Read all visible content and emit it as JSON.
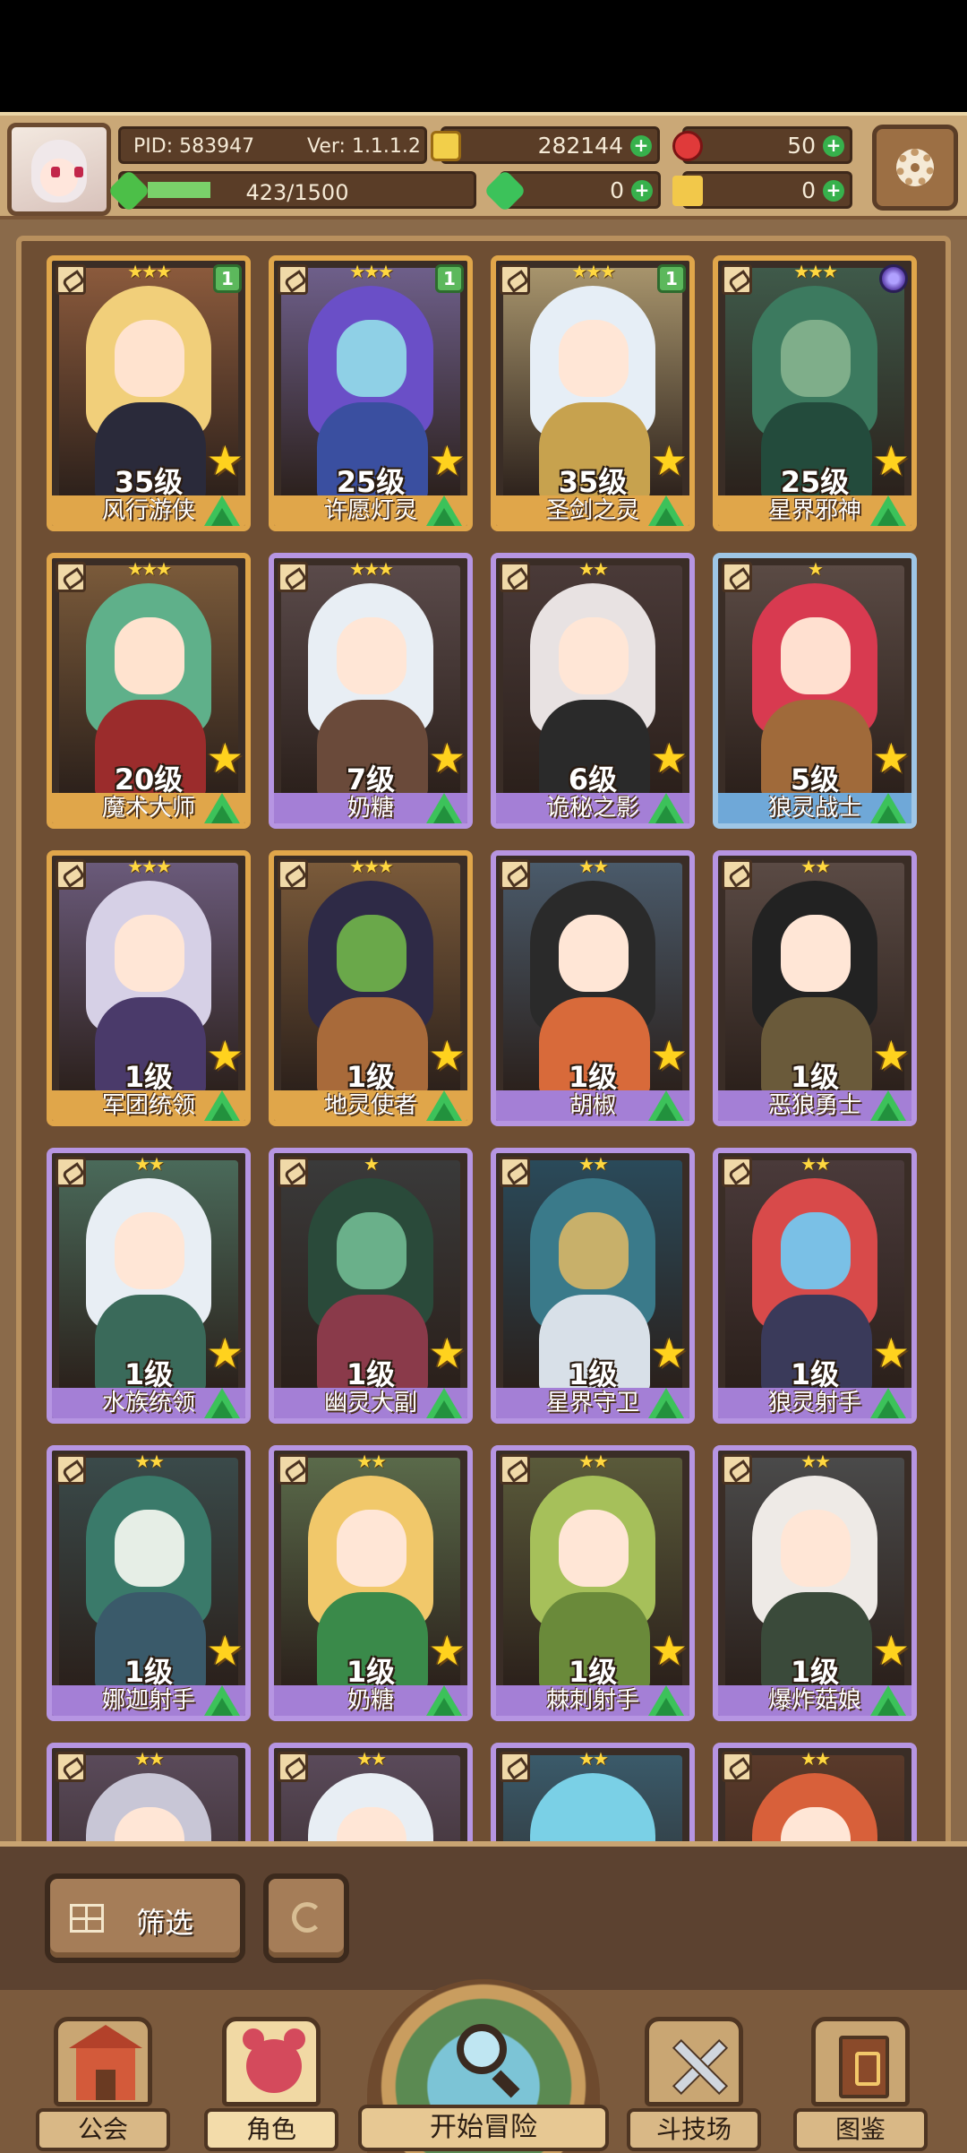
{
  "header": {
    "pid": "PID: 583947",
    "version": "Ver: 1.1.1.2",
    "gold": "282144",
    "gems": "50",
    "xp": "423/1500",
    "clover": "0",
    "key": "0"
  },
  "colors": {
    "orange_frame": "#e0a64a",
    "purple_frame": "#b695e2",
    "blue_frame": "#9ec6e6",
    "upgrade": "#3cc25a"
  },
  "cards": [
    {
      "name": "风行游侠",
      "level": "35级",
      "stars": "★★★",
      "rarity": "orange",
      "badge": "1",
      "hair": "#f1cf7a",
      "skin": "#ffe3cf",
      "body": "#2a2a3a",
      "bg": "#8b5a3c"
    },
    {
      "name": "许愿灯灵",
      "level": "25级",
      "stars": "★★★",
      "rarity": "orange",
      "badge": "1",
      "hair": "#6a4fc7",
      "skin": "#8fd0e6",
      "body": "#3a4fa0",
      "bg": "#6e5f8a"
    },
    {
      "name": "圣剑之灵",
      "level": "35级",
      "stars": "★★★",
      "rarity": "orange",
      "badge": "1",
      "hair": "#e6eef6",
      "skin": "#ffe6d6",
      "body": "#c7a24e",
      "bg": "#a7946c"
    },
    {
      "name": "星界邪神",
      "level": "25级",
      "stars": "★★★",
      "rarity": "orange",
      "badge": "orb",
      "hair": "#3c7a5f",
      "skin": "#7fae8a",
      "body": "#234b3c",
      "bg": "#3f5a4a"
    },
    {
      "name": "魔术大师",
      "level": "20级",
      "stars": "★★★",
      "rarity": "orange",
      "badge": "",
      "hair": "#5fb08a",
      "skin": "#ffe3cf",
      "body": "#9b2c2c",
      "bg": "#7a5a3a"
    },
    {
      "name": "奶糖",
      "level": "7级",
      "stars": "★★★",
      "rarity": "purple",
      "badge": "",
      "hair": "#e8eef4",
      "skin": "#ffe6d6",
      "body": "#6a4a3a",
      "bg": "#5a4a4a"
    },
    {
      "name": "诡秘之影",
      "level": "6级",
      "stars": "★★",
      "rarity": "purple",
      "badge": "",
      "hair": "#e8e2e2",
      "skin": "#ffe6d6",
      "body": "#2a2a2a",
      "bg": "#4a3a38"
    },
    {
      "name": "狼灵战士",
      "level": "5级",
      "stars": "★",
      "rarity": "blue",
      "badge": "",
      "hair": "#d83a50",
      "skin": "#ffe0d0",
      "body": "#a06a3a",
      "bg": "#5a4a44"
    },
    {
      "name": "军团统领",
      "level": "1级",
      "stars": "★★★",
      "rarity": "orange",
      "badge": "",
      "hair": "#d6d0e6",
      "skin": "#ffe6d6",
      "body": "#4a3a6a",
      "bg": "#6a5a7a"
    },
    {
      "name": "地灵使者",
      "level": "1级",
      "stars": "★★★",
      "rarity": "orange",
      "badge": "",
      "hair": "#2e2a46",
      "skin": "#6aa84a",
      "body": "#a86a3a",
      "bg": "#7a5a3a"
    },
    {
      "name": "胡椒",
      "level": "1级",
      "stars": "★★",
      "rarity": "purple",
      "badge": "",
      "hair": "#2a2a2a",
      "skin": "#ffe6d6",
      "body": "#d86a3a",
      "bg": "#4a5a6a"
    },
    {
      "name": "恶狼勇士",
      "level": "1级",
      "stars": "★★",
      "rarity": "purple",
      "badge": "",
      "hair": "#222",
      "skin": "#ffe6d6",
      "body": "#6a5a3a",
      "bg": "#5a4a44"
    },
    {
      "name": "水族统领",
      "level": "1级",
      "stars": "★★",
      "rarity": "purple",
      "badge": "",
      "hair": "#e8eef4",
      "skin": "#ffe6d6",
      "body": "#3a6a5a",
      "bg": "#4a6a5a"
    },
    {
      "name": "幽灵大副",
      "level": "1级",
      "stars": "★",
      "rarity": "purple",
      "badge": "",
      "hair": "#2a4a3a",
      "skin": "#6ab08a",
      "body": "#8a3a4a",
      "bg": "#3a3a3a"
    },
    {
      "name": "星界守卫",
      "level": "1级",
      "stars": "★★",
      "rarity": "purple",
      "badge": "",
      "hair": "#3a7a8a",
      "skin": "#c8b06a",
      "body": "#d8e0e8",
      "bg": "#2a4a5a"
    },
    {
      "name": "狼灵射手",
      "level": "1级",
      "stars": "★★",
      "rarity": "purple",
      "badge": "",
      "hair": "#d84a4a",
      "skin": "#7ac0e6",
      "body": "#3a3a5a",
      "bg": "#4a3a3a"
    },
    {
      "name": "娜迦射手",
      "level": "1级",
      "stars": "★★",
      "rarity": "purple",
      "badge": "",
      "hair": "#3a7a6a",
      "skin": "#e6eee6",
      "body": "#3a5a6a",
      "bg": "#3a4a4a"
    },
    {
      "name": "奶糖",
      "level": "1级",
      "stars": "★★",
      "rarity": "purple",
      "badge": "",
      "hair": "#f1c86a",
      "skin": "#ffe6d6",
      "body": "#3a8a4a",
      "bg": "#5a6a4a"
    },
    {
      "name": "棘刺射手",
      "level": "1级",
      "stars": "★★",
      "rarity": "purple",
      "badge": "",
      "hair": "#a6c05a",
      "skin": "#ffe6d6",
      "body": "#6a8a3a",
      "bg": "#5a5a3a"
    },
    {
      "name": "爆炸菇娘",
      "level": "1级",
      "stars": "★★",
      "rarity": "purple",
      "badge": "",
      "hair": "#eeeae6",
      "skin": "#ffe6d6",
      "body": "#3a4a3a",
      "bg": "#4a4a4a"
    },
    {
      "name": "",
      "level": "",
      "stars": "★★",
      "rarity": "purple",
      "badge": "",
      "hair": "#c8c6d6",
      "skin": "#ffe6d6",
      "body": "#4a4a5a",
      "bg": "#5a4a5a"
    },
    {
      "name": "",
      "level": "",
      "stars": "★★",
      "rarity": "purple",
      "badge": "",
      "hair": "#e8eef4",
      "skin": "#ffe6d6",
      "body": "#4a4a5a",
      "bg": "#5a4a5a"
    },
    {
      "name": "",
      "level": "",
      "stars": "★★",
      "rarity": "purple",
      "badge": "",
      "hair": "#7ad0e6",
      "skin": "#7ad0e6",
      "body": "#3a6a8a",
      "bg": "#3a5a6a"
    },
    {
      "name": "",
      "level": "",
      "stars": "★★",
      "rarity": "purple",
      "badge": "",
      "hair": "#d8603a",
      "skin": "#ffe6d6",
      "body": "#6a3a2a",
      "bg": "#5a3a2a"
    }
  ],
  "bottom": {
    "filter_label": "筛选",
    "nav": [
      "公会",
      "角色",
      "开始冒险",
      "斗技场",
      "图鉴"
    ]
  }
}
